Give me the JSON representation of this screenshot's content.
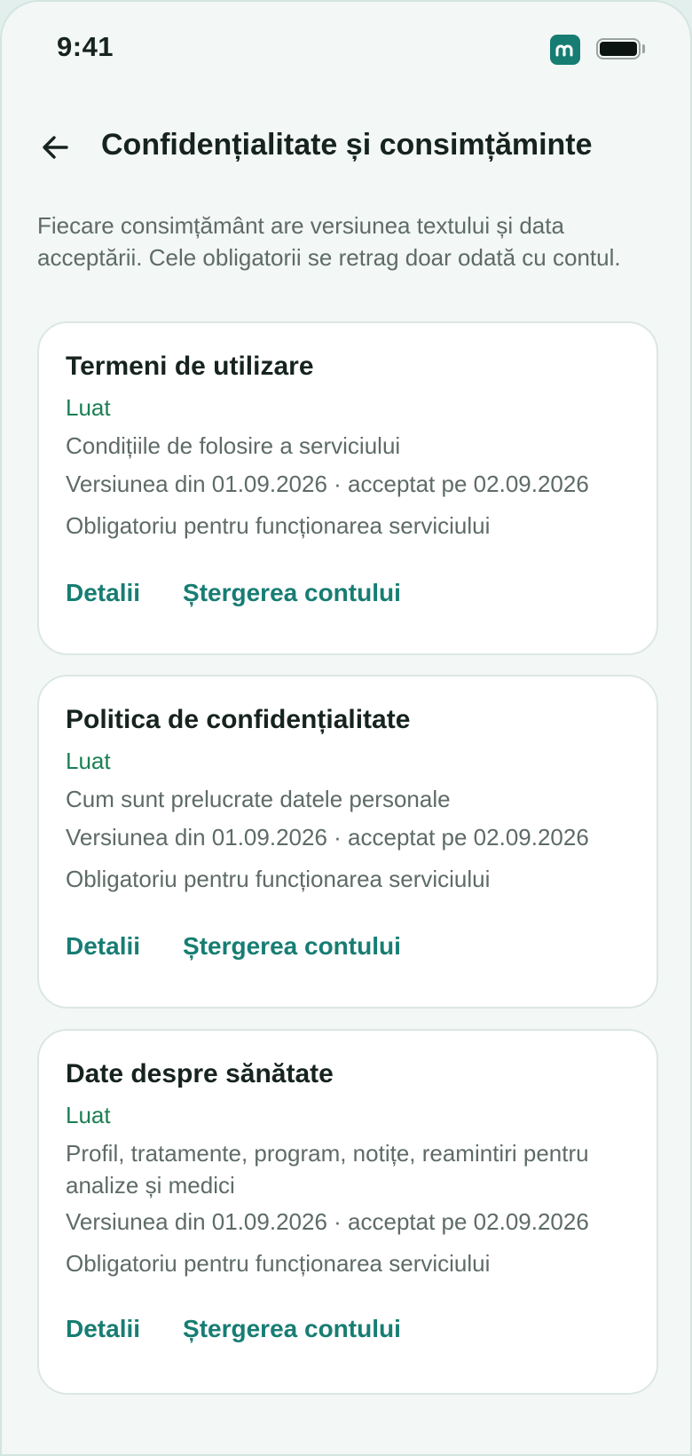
{
  "status_bar": {
    "time": "9:41",
    "app_icon": "app-logo-icon",
    "battery_icon": "battery-full-icon"
  },
  "header": {
    "back_icon": "arrow-left-icon",
    "title": "Confidențialitate și consimțăminte"
  },
  "intro_text": "Fiecare consimțământ are versiunea textului și data acceptării. Cele obligatorii se retrag doar odată cu contul.",
  "colors": {
    "accent": "#177d73",
    "status_taken": "#1c7f55",
    "background": "#f3f7f6",
    "card": "#ffffff"
  },
  "consents": [
    {
      "title": "Termeni de utilizare",
      "status": "Luat",
      "description": "Condițiile de folosire a serviciului",
      "version": "Versiunea din 01.09.2026 · acceptat pe 02.09.2026",
      "note": "Obligatoriu pentru funcționarea serviciului",
      "details_label": "Detalii",
      "delete_label": "Ștergerea contului"
    },
    {
      "title": "Politica de confidențialitate",
      "status": "Luat",
      "description": "Cum sunt prelucrate datele personale",
      "version": "Versiunea din 01.09.2026 · acceptat pe 02.09.2026",
      "note": "Obligatoriu pentru funcționarea serviciului",
      "details_label": "Detalii",
      "delete_label": "Ștergerea contului"
    },
    {
      "title": "Date despre sănătate",
      "status": "Luat",
      "description": "Profil, tratamente, program, notițe, reamintiri pentru analize și medici",
      "version": "Versiunea din 01.09.2026 · acceptat pe 02.09.2026",
      "note": "Obligatoriu pentru funcționarea serviciului",
      "details_label": "Detalii",
      "delete_label": "Ștergerea contului"
    }
  ]
}
